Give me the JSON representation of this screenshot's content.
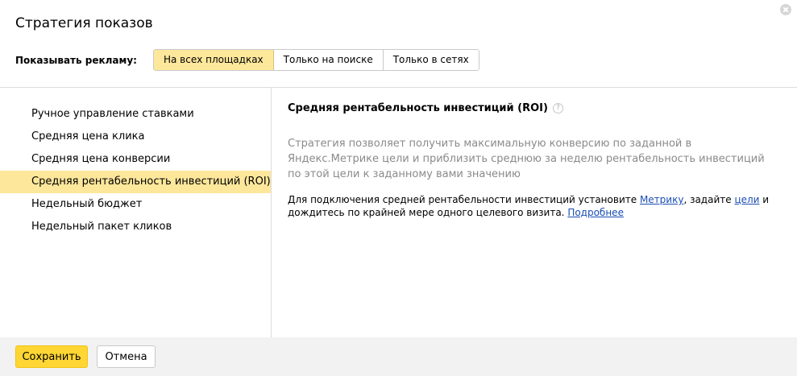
{
  "dialog": {
    "title": "Стратегия показов",
    "close_icon": "close-icon"
  },
  "show": {
    "label": "Показывать рекламу:",
    "options": [
      "На всех площадках",
      "Только на поиске",
      "Только в сетях"
    ],
    "selected": "На всех площадках"
  },
  "strategies": {
    "items": [
      "Ручное управление ставками",
      "Средняя цена клика",
      "Средняя цена конверсии",
      "Средняя рентабельность инвестиций (ROI)",
      "Недельный бюджет",
      "Недельный пакет кликов"
    ],
    "selected": "Средняя рентабельность инвестиций (ROI)"
  },
  "detail": {
    "title": "Средняя рентабельность инвестиций (ROI)",
    "help_icon": "question-icon",
    "help_glyph": "?",
    "description": "Стратегия позволяет получить максимальную конверсию по заданной в Яндекс.Метрике цели и приблизить среднюю за неделю рентабельность инвестиций по этой цели к заданному вами значению",
    "note": {
      "part1": "Для подключения средней рентабельности инвестиций установите ",
      "link_metrika": "Метрику",
      "part2": ", задайте ",
      "link_goals": "цели",
      "part3": " и дождитесь по крайней мере одного целевого визита. ",
      "link_more": "Подробнее"
    }
  },
  "footer": {
    "save_label": "Сохранить",
    "cancel_label": "Отмена"
  },
  "colors": {
    "accent_yellow": "#ffd633",
    "selected_bg": "#fde79b",
    "link": "#1a4db3",
    "muted_text": "#8a8a8a",
    "footer_bg": "#f2f2f2"
  }
}
